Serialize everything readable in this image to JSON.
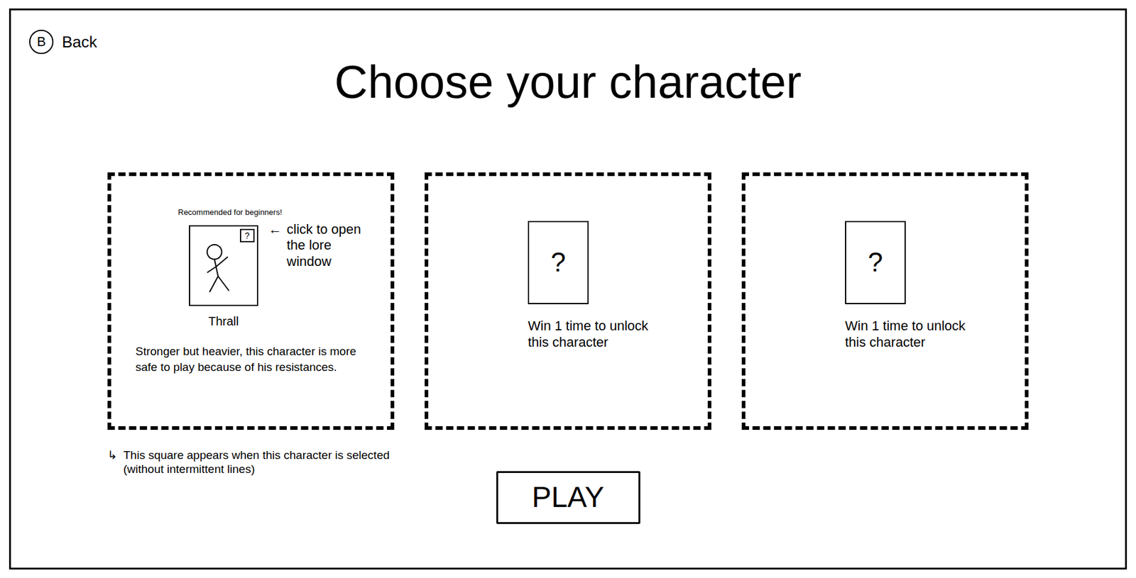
{
  "back": {
    "key": "B",
    "label": "Back"
  },
  "title": "Choose your character",
  "characters": [
    {
      "kind": "unlocked",
      "selected": false,
      "badge": "Recommended for beginners!",
      "name": "Thrall",
      "lore_button": "?",
      "lore_arrow": "←",
      "lore_note": "click to open the lore window",
      "description": "Stronger but heavier, this character is more safe to play because of his resistances."
    },
    {
      "kind": "locked",
      "selected": false,
      "portrait": "?",
      "description": "Win 1 time to unlock this character"
    },
    {
      "kind": "locked",
      "selected": false,
      "portrait": "?",
      "description": "Win 1 time to unlock this character"
    }
  ],
  "selection_note": {
    "arrow": "↳",
    "text": "This square appears when this character is selected (without intermittent lines)"
  },
  "play_button": "PLAY"
}
